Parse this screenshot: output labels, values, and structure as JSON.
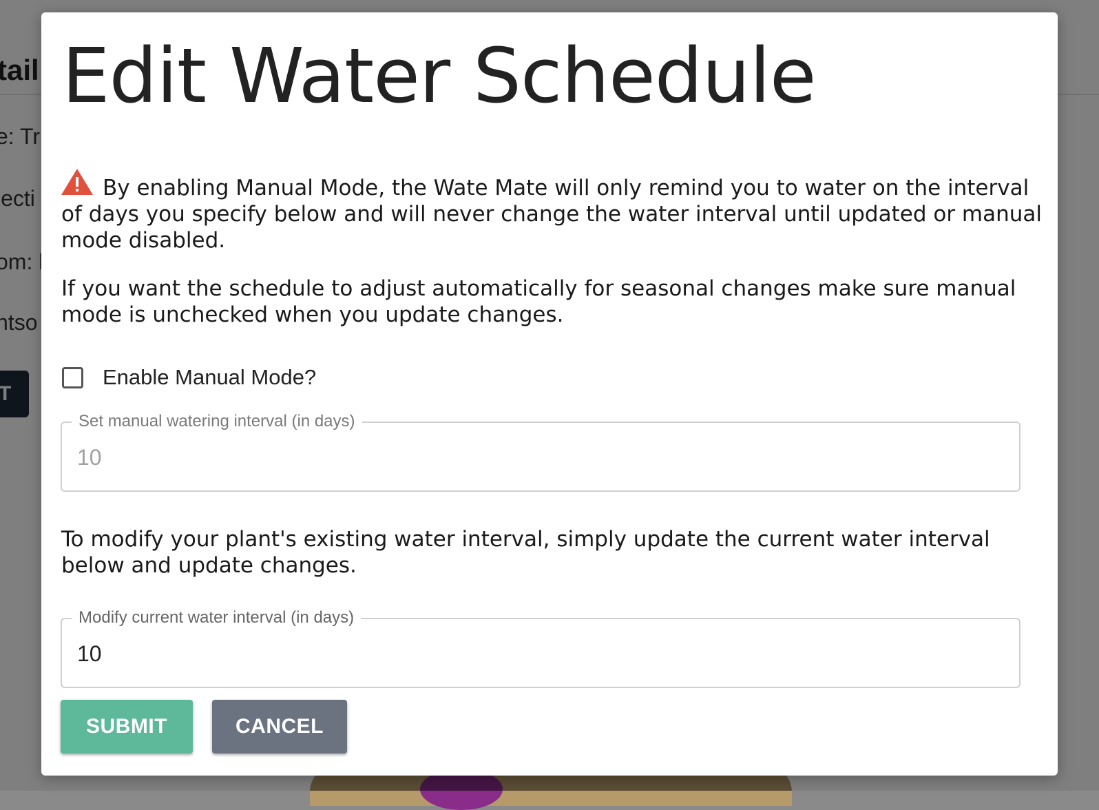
{
  "background": {
    "title_fragment": "tail",
    "lines": [
      "e: Tr",
      "lecti",
      "om: k",
      "ntso"
    ],
    "button_fragment": "T"
  },
  "modal": {
    "title": "Edit Water Schedule",
    "warning_icon": "warning-triangle-icon",
    "warning_color": "#e0503c",
    "paragraph1": "By enabling Manual Mode, the Wate Mate will only remind you to water on the interval of days you specify below and will never change the water interval until updated or manual mode disabled.",
    "paragraph2": "If you want the schedule to adjust automatically for seasonal changes make sure manual mode is unchecked when you update changes.",
    "checkbox": {
      "label": "Enable Manual Mode?",
      "checked": false
    },
    "manual_interval": {
      "label": "Set manual watering interval (in days)",
      "value": "10",
      "disabled": true
    },
    "paragraph3": "To modify your plant's existing water interval, simply update the current water interval below and update changes.",
    "current_interval": {
      "label": "Modify current water interval (in days)",
      "value": "10"
    },
    "submit_label": "SUBMIT",
    "cancel_label": "CANCEL",
    "submit_color": "#5db99a",
    "cancel_color": "#6b7280"
  }
}
